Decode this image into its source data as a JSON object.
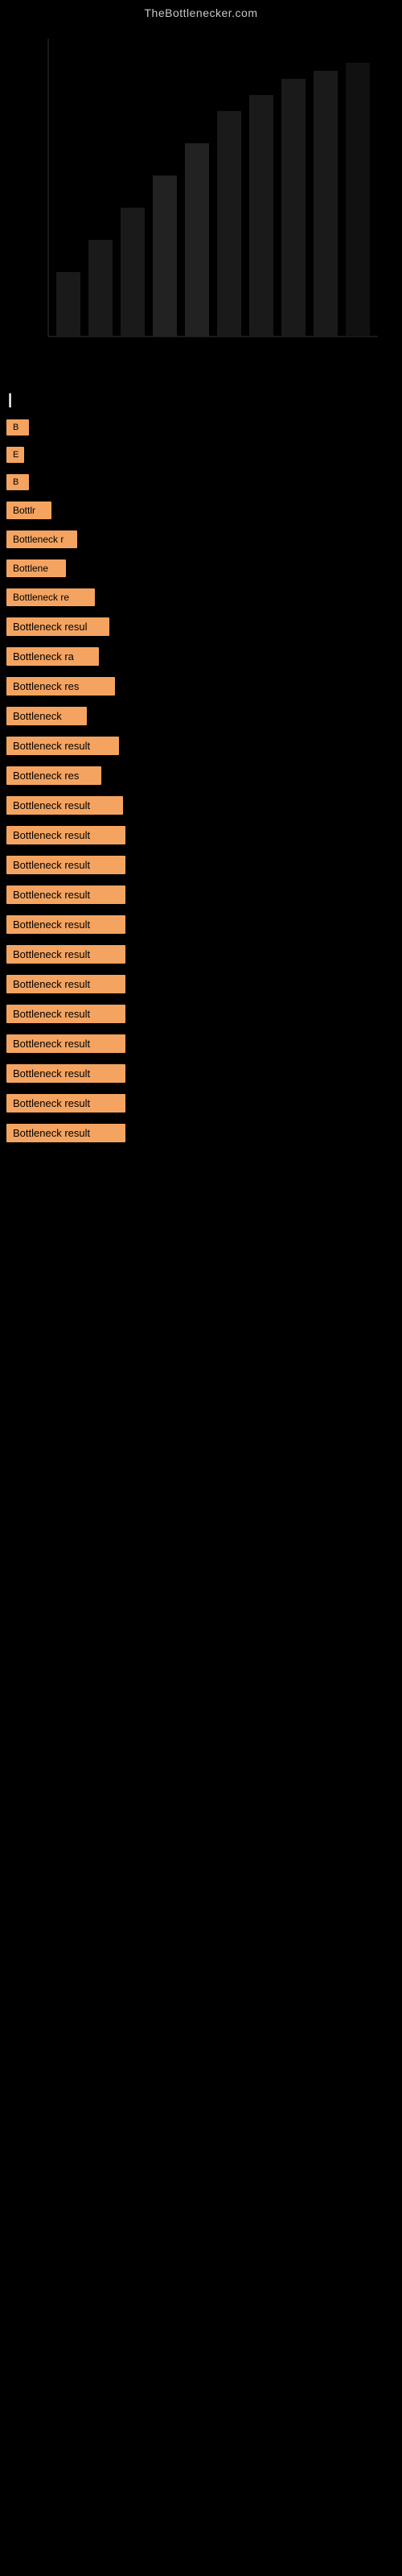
{
  "site": {
    "title": "TheBottlenecker.com"
  },
  "results": {
    "section_label": "|",
    "items": [
      {
        "id": 1,
        "label": "B",
        "class": "r1"
      },
      {
        "id": 2,
        "label": "E",
        "class": "r2"
      },
      {
        "id": 3,
        "label": "B",
        "class": "r3"
      },
      {
        "id": 4,
        "label": "Bottlr",
        "class": "r4"
      },
      {
        "id": 5,
        "label": "Bottleneck r",
        "class": "r5"
      },
      {
        "id": 6,
        "label": "Bottlene",
        "class": "r6"
      },
      {
        "id": 7,
        "label": "Bottleneck re",
        "class": "r7"
      },
      {
        "id": 8,
        "label": "Bottleneck resul",
        "class": "r8"
      },
      {
        "id": 9,
        "label": "Bottleneck ra",
        "class": "r9"
      },
      {
        "id": 10,
        "label": "Bottleneck res",
        "class": "r10"
      },
      {
        "id": 11,
        "label": "Bottleneck",
        "class": "r11"
      },
      {
        "id": 12,
        "label": "Bottleneck result",
        "class": "r12"
      },
      {
        "id": 13,
        "label": "Bottleneck res",
        "class": "r13"
      },
      {
        "id": 14,
        "label": "Bottleneck result",
        "class": "r14"
      },
      {
        "id": 15,
        "label": "Bottleneck result",
        "class": "r15"
      },
      {
        "id": 16,
        "label": "Bottleneck result",
        "class": "r16"
      },
      {
        "id": 17,
        "label": "Bottleneck result",
        "class": "r17"
      },
      {
        "id": 18,
        "label": "Bottleneck result",
        "class": "r18"
      },
      {
        "id": 19,
        "label": "Bottleneck result",
        "class": "r19"
      },
      {
        "id": 20,
        "label": "Bottleneck result",
        "class": "r20"
      },
      {
        "id": 21,
        "label": "Bottleneck result",
        "class": "r21"
      },
      {
        "id": 22,
        "label": "Bottleneck result",
        "class": "r22"
      },
      {
        "id": 23,
        "label": "Bottleneck result",
        "class": "r23"
      },
      {
        "id": 24,
        "label": "Bottleneck result",
        "class": "r24"
      },
      {
        "id": 25,
        "label": "Bottleneck result",
        "class": "r25"
      }
    ]
  }
}
